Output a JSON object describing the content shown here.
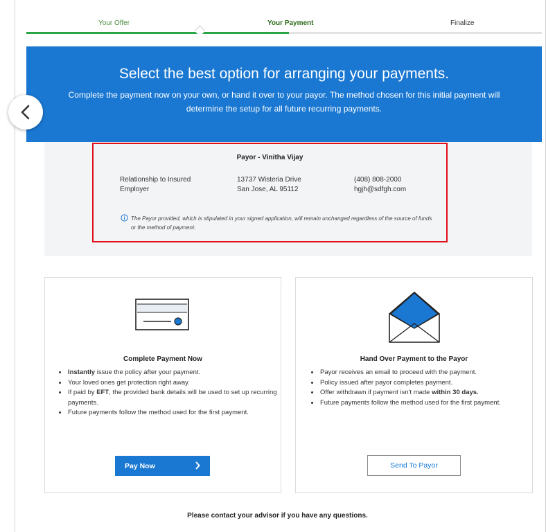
{
  "stepper": {
    "steps": [
      {
        "label": "Your Offer"
      },
      {
        "label": "Your Payment"
      },
      {
        "label": "Finalize"
      }
    ],
    "progress": 0.51
  },
  "banner": {
    "title": "Select the best option for arranging your payments.",
    "subtitle": "Complete the payment now on your own, or hand it over to your payor. The method chosen for this initial payment will determine the setup for all future recurring payments."
  },
  "payor": {
    "title": "Payor - Vinitha Vijay",
    "relationship_label": "Relationship to Insured",
    "relationship_value": "Employer",
    "address_line1": "13737 Wisteria Drive",
    "address_line2": "San Jose, AL 95112",
    "phone": "(408) 808-2000",
    "email": "hgjh@sdfgh.com",
    "note": "The Payor provided, which is stipulated in your signed application, will remain unchanged regardless of the source of funds or the method of payment."
  },
  "pay_now": {
    "title": "Complete Payment Now",
    "b1_strong": "Instantly",
    "b1_rest": " issue the policy after your payment.",
    "b2": "Your loved ones get protection right away.",
    "b3_pre": "If paid by ",
    "b3_strong": "EFT",
    "b3_rest": ", the provided bank details will be used to set up recurring payments.",
    "b4": "Future payments follow the method used for the first payment.",
    "button": "Pay Now"
  },
  "hand_over": {
    "title": "Hand Over Payment to the Payor",
    "b1": "Payor receives an email to proceed with the payment.",
    "b2": "Policy issued after payor completes payment.",
    "b3_pre": "Offer withdrawn if payment isn't made ",
    "b3_strong": "within 30 days.",
    "b4": "Future payments follow the method used for the first payment.",
    "button": "Send To Payor"
  },
  "footer": {
    "text": "Please contact your advisor if you have any questions."
  },
  "icons": {
    "back": "chevron-left-icon",
    "info": "info-icon",
    "card": "credit-card-icon",
    "envelope": "open-envelope-icon",
    "arrow": "chevron-right-icon"
  },
  "colors": {
    "brand_blue": "#1a78d2",
    "progress_green": "#2aa646",
    "highlight_red": "#e0101a"
  }
}
